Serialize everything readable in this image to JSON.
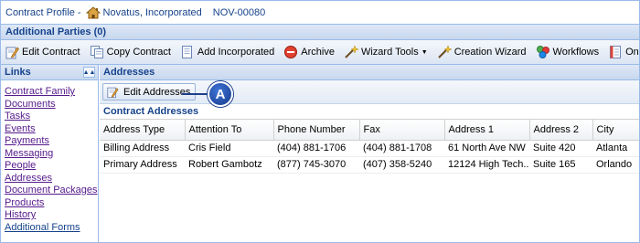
{
  "header": {
    "profile_label": "Contract Profile -",
    "company": "Novatus, Incorporated",
    "code": "NOV-00080"
  },
  "section_title": "Additional Parties (0)",
  "toolbar": {
    "buttons": [
      {
        "label": "Edit Contract",
        "icon": "edit-icon"
      },
      {
        "label": "Copy Contract",
        "icon": "copy-icon"
      },
      {
        "label": "Add Incorporated",
        "icon": "document-add-icon"
      },
      {
        "label": "Archive",
        "icon": "archive-icon"
      },
      {
        "label": "Wizard Tools",
        "icon": "wand-icon"
      },
      {
        "label": "Creation Wizard",
        "icon": "wand-icon"
      },
      {
        "label": "Workflows",
        "icon": "workflow-icon"
      },
      {
        "label": "One Click Report",
        "icon": "report-icon"
      }
    ]
  },
  "links": {
    "title": "Links",
    "items": [
      "Contract Family",
      "Documents",
      "Tasks",
      "Events",
      "Payments",
      "Messaging",
      "People",
      "Addresses",
      "Document Packages",
      "Products",
      "History",
      "Additional Forms"
    ]
  },
  "main": {
    "title": "Addresses",
    "edit_button": "Edit Addresses",
    "callout": "A",
    "sub_title": "Contract Addresses",
    "columns": [
      "Address Type",
      "Attention To",
      "Phone Number",
      "Fax",
      "Address 1",
      "Address 2",
      "City"
    ],
    "rows": [
      [
        "Billing Address",
        "Cris Field",
        "(404) 881-1706",
        "(404) 881-1708",
        "61 North Ave NW",
        "Suite 420",
        "Atlanta"
      ],
      [
        "Primary Address",
        "Robert Gambotz",
        "(877) 745-3070",
        "(407) 358-5240",
        "12124 High Tech...",
        "Suite 165",
        "Orlando"
      ]
    ]
  },
  "colors": {
    "header_blue": "#15428b",
    "panel_border": "#99bbe8",
    "callout_blue": "#163a8c"
  }
}
